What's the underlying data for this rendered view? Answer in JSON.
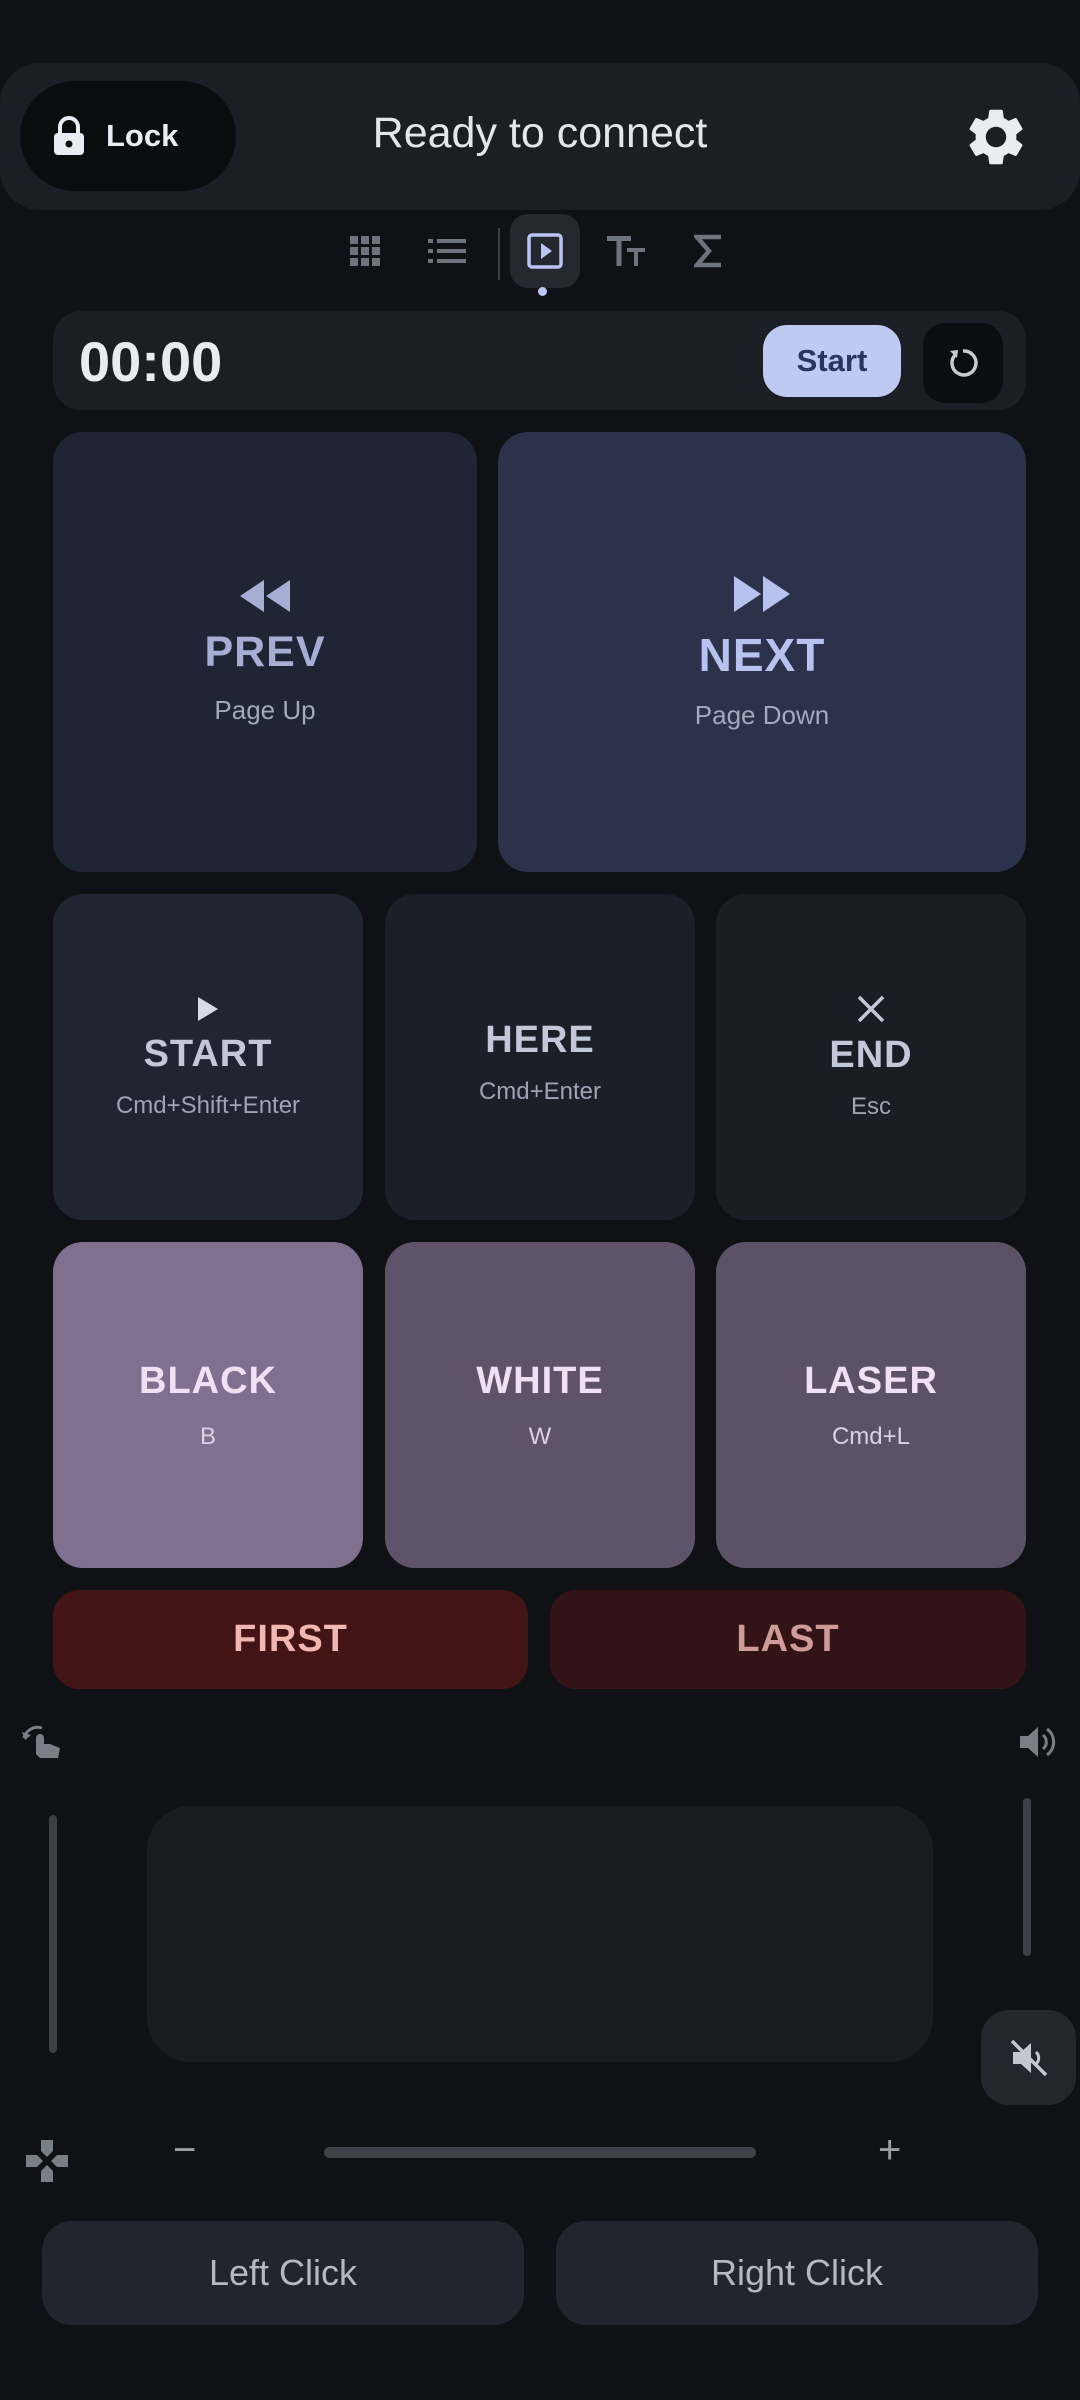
{
  "topbar": {
    "lock_label": "Lock",
    "status": "Ready to connect"
  },
  "tabs": [
    {
      "icon": "grid-icon",
      "active": false
    },
    {
      "icon": "list-icon",
      "active": false
    },
    {
      "icon": "present-play-icon",
      "active": true
    },
    {
      "icon": "text-size-icon",
      "active": false
    },
    {
      "icon": "sigma-icon",
      "active": false
    }
  ],
  "timer": {
    "value": "00:00",
    "start_label": "Start"
  },
  "nav": {
    "prev": {
      "label": "PREV",
      "key": "Page Up"
    },
    "next": {
      "label": "NEXT",
      "key": "Page Down"
    }
  },
  "controls": {
    "start": {
      "label": "START",
      "key": "Cmd+Shift+Enter"
    },
    "here": {
      "label": "HERE",
      "key": "Cmd+Enter"
    },
    "end": {
      "label": "END",
      "key": "Esc"
    }
  },
  "screen": {
    "black": {
      "label": "BLACK",
      "key": "B"
    },
    "white": {
      "label": "WHITE",
      "key": "W"
    },
    "laser": {
      "label": "LASER",
      "key": "Cmd+L"
    }
  },
  "jump": {
    "first": "FIRST",
    "last": "LAST"
  },
  "trackpad": {
    "minus": "−",
    "plus": "+"
  },
  "mouse": {
    "left": "Left Click",
    "right": "Right Click"
  },
  "colors": {
    "accent": "#bfcaf3",
    "background": "#0f1115",
    "danger": "#421415"
  }
}
